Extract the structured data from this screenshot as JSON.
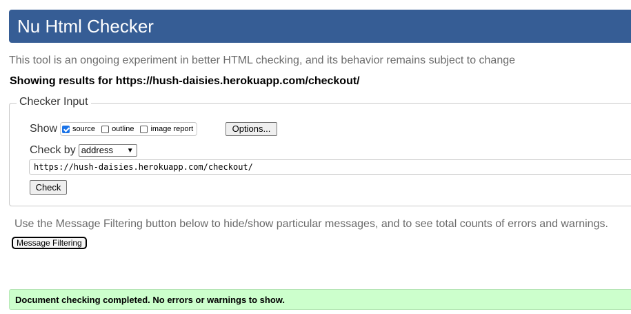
{
  "header": {
    "title": "Nu Html Checker",
    "background_color": "#365d95"
  },
  "intro": "This tool is an ongoing experiment in better HTML checking, and its behavior remains subject to change",
  "showing_results": "Showing results for https://hush-daisies.herokuapp.com/checkout/",
  "checker_input": {
    "legend": "Checker Input",
    "show_label": "Show",
    "show_options": [
      {
        "label": "source",
        "checked": true
      },
      {
        "label": "outline",
        "checked": false
      },
      {
        "label": "image report",
        "checked": false
      }
    ],
    "options_button": "Options...",
    "check_by_label": "Check by",
    "check_by_value": "address",
    "url_value": "https://hush-daisies.herokuapp.com/checkout/",
    "check_button": "Check"
  },
  "filter_info": "Use the Message Filtering button below to hide/show particular messages, and to see total counts of errors and warnings.",
  "filter_button": "Message Filtering",
  "result": {
    "message": "Document checking completed. No errors or warnings to show.",
    "color": "#ccffcc"
  }
}
